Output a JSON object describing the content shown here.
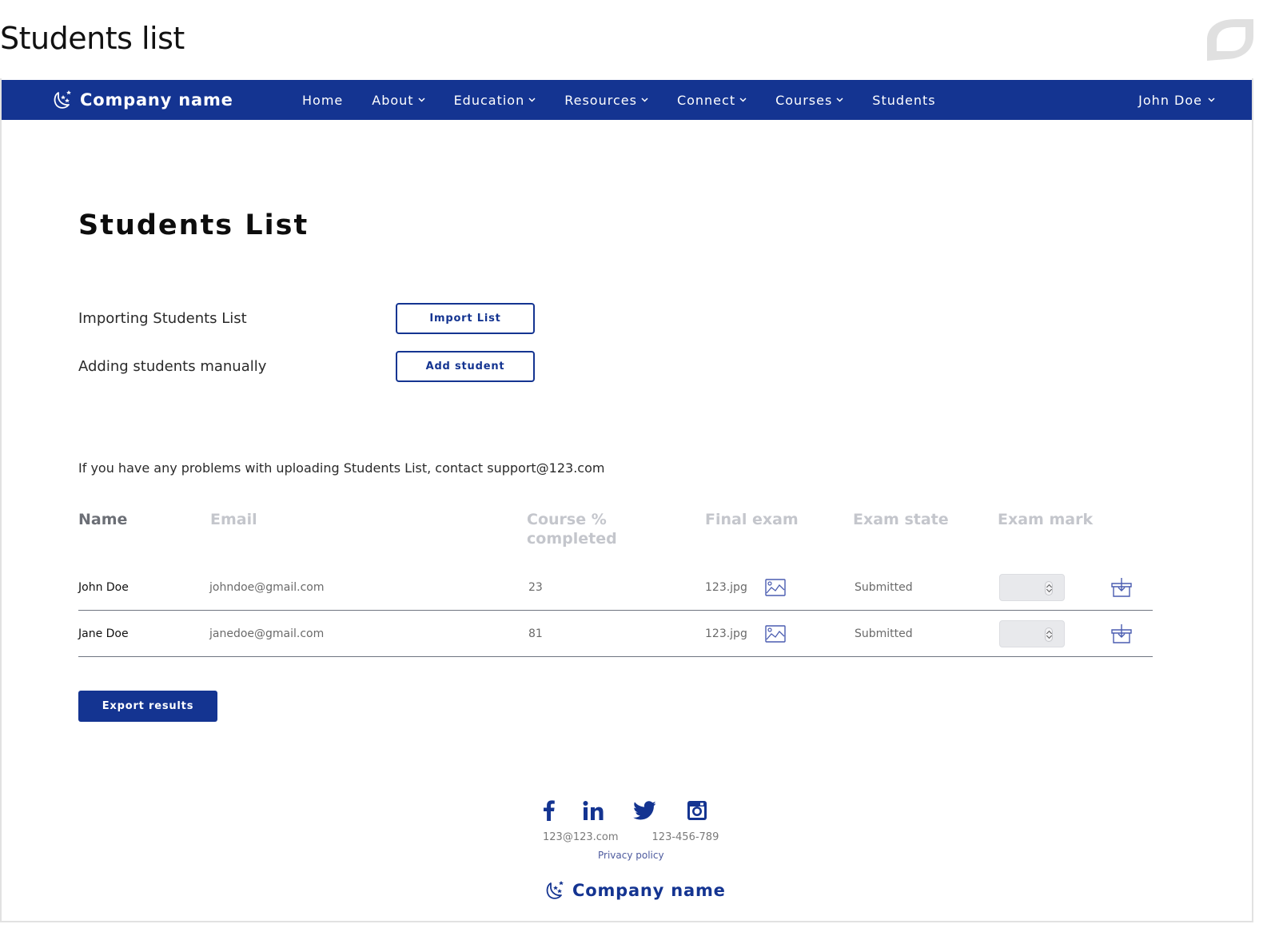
{
  "page_heading": "Students list",
  "navbar": {
    "brand": "Company name",
    "items": [
      {
        "label": "Home",
        "dropdown": false
      },
      {
        "label": "About",
        "dropdown": true
      },
      {
        "label": "Education",
        "dropdown": true
      },
      {
        "label": "Resources",
        "dropdown": true
      },
      {
        "label": "Connect",
        "dropdown": true
      },
      {
        "label": "Courses",
        "dropdown": true
      },
      {
        "label": "Students",
        "dropdown": false
      }
    ],
    "user": "John Doe"
  },
  "main": {
    "title": "Students List",
    "actions": [
      {
        "label": "Importing Students List",
        "button": "Import List"
      },
      {
        "label": "Adding students manually",
        "button": "Add student"
      }
    ],
    "support_note": "If you have any problems with uploading Students List, contact support@123.com"
  },
  "table": {
    "headers": {
      "name": "Name",
      "email": "Email",
      "course_line1": "Course %",
      "course_line2": "completed",
      "final_exam": "Final exam",
      "exam_state": "Exam state",
      "exam_mark": "Exam mark"
    },
    "rows": [
      {
        "name": "John Doe",
        "email": "johndoe@gmail.com",
        "course_pct": "23",
        "final_exam": "123.jpg",
        "exam_state": "Submitted",
        "exam_mark": ""
      },
      {
        "name": "Jane Doe",
        "email": "janedoe@gmail.com",
        "course_pct": "81",
        "final_exam": "123.jpg",
        "exam_state": "Submitted",
        "exam_mark": ""
      }
    ]
  },
  "export_button": "Export results",
  "footer": {
    "social_icons": [
      "facebook-icon",
      "linkedin-icon",
      "twitter-icon",
      "instagram-icon"
    ],
    "email": "123@123.com",
    "phone": "123-456-789",
    "privacy": "Privacy policy",
    "brand": "Company name"
  },
  "colors": {
    "primary": "#143491",
    "header_muted": "#c4c6cc",
    "header_name": "#6c6f76"
  }
}
